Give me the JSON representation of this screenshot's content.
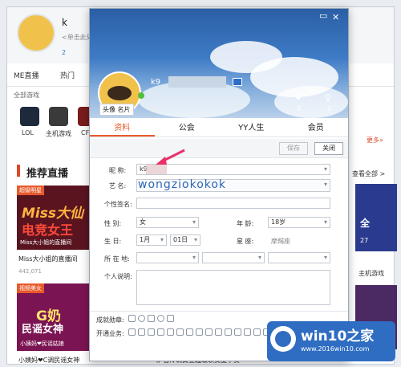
{
  "background_app": {
    "user_name": "k",
    "signature": "<单击此处",
    "stats": "2",
    "tabs": [
      "ME直播",
      "热门",
      "全部游戏"
    ],
    "games": [
      "LOL",
      "主机游戏",
      "CF"
    ],
    "section_title": "推荐直播",
    "card1": {
      "tag": "超级明星",
      "big1": "Miss大仙",
      "big2": "电竞女王",
      "caption": "Miss大小姐的直播间",
      "title": "Miss大小姐的直播间",
      "views": "442,071"
    },
    "card2": {
      "tag": "视频美女",
      "big1": "G奶",
      "big2": "民谣女神",
      "caption": "小姨妈❤民谣姑娘",
      "title": "小姨妈❤C调民谣女神"
    },
    "card3_title": "炉石传说黄金超级联赛夏季赛",
    "right_more": "更多»",
    "right_all": "查看全部 >",
    "right_card_text": "全",
    "right_card_num": "27",
    "right_label": "主机游戏"
  },
  "dialog": {
    "name": "k9",
    "avatar_buttons": "头像  名片",
    "likes": "0",
    "fans": "0",
    "tabs": [
      {
        "label": "资料",
        "active": true
      },
      {
        "label": "公会",
        "active": false
      },
      {
        "label": "YY人生",
        "active": false
      },
      {
        "label": "会员",
        "active": false
      }
    ],
    "save_label": "保存",
    "close_label": "关闭",
    "fields": {
      "nickname_label": "昵    称:",
      "nickname_value": "k9",
      "art_name_label": "艺    名:",
      "art_name_value": "wongziokokok",
      "signature_label": "个性签名:",
      "signature_value": "",
      "gender_label": "性    别:",
      "gender_value": "女",
      "age_label": "年    龄:",
      "age_value": "18岁",
      "birthday_label": "生    日:",
      "birth_month": "1月",
      "birth_day": "01日",
      "constellation_label": "星    座:",
      "constellation_value": "摩羯座",
      "location_label": "所 在 地:",
      "bio_label": "个人说明:"
    },
    "badges_label": "成就勋章:",
    "services_label": "开通业务:"
  },
  "watermark": {
    "title": "win10之家",
    "url": "www.2016win10.com"
  },
  "colors": {
    "accent": "#e85a2b",
    "link": "#2d7dd2",
    "banner": "#3e7bc6"
  }
}
